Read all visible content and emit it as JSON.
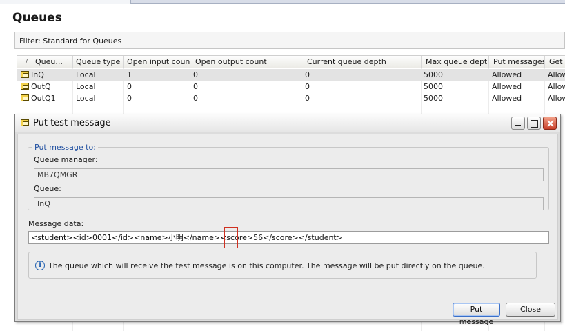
{
  "view": {
    "title": "Queues",
    "filter_text": "Filter: Standard for Queues"
  },
  "table": {
    "columns": [
      "Queu...",
      "Queue type",
      "Open input count",
      "Open output count",
      "Current queue depth",
      "Max queue depth",
      "Put messages",
      "Get m"
    ],
    "rows": [
      {
        "name": "InQ",
        "type": "Local",
        "open_input": "1",
        "open_output": "0",
        "current_depth": "0",
        "max_depth": "5000",
        "put": "Allowed",
        "get": "Allow",
        "selected": true
      },
      {
        "name": "OutQ",
        "type": "Local",
        "open_input": "0",
        "open_output": "0",
        "current_depth": "0",
        "max_depth": "5000",
        "put": "Allowed",
        "get": "Allow",
        "selected": false
      },
      {
        "name": "OutQ1",
        "type": "Local",
        "open_input": "0",
        "open_output": "0",
        "current_depth": "0",
        "max_depth": "5000",
        "put": "Allowed",
        "get": "Allow",
        "selected": false
      }
    ]
  },
  "dialog": {
    "title": "Put test message",
    "group_label": "Put message to:",
    "queue_manager_label": "Queue manager:",
    "queue_manager_value": "MB7QMGR",
    "queue_label": "Queue:",
    "queue_value": "InQ",
    "message_data_label": "Message data:",
    "message_data_value": "<student><id>0001</id><name>小明</name><score>56</score></student>",
    "info_text": "The queue which will receive the test message is on this computer. The message will be put directly on the queue.",
    "put_button": "Put message",
    "close_button": "Close"
  },
  "icons": {
    "queue": "queue-icon",
    "info": "info-icon",
    "minimize": "minimize-icon",
    "maximize": "maximize-icon",
    "close": "close-icon"
  },
  "colors": {
    "group_legend": "#1f4fa0",
    "highlight": "#d03020",
    "close_button": "#c9402a"
  }
}
